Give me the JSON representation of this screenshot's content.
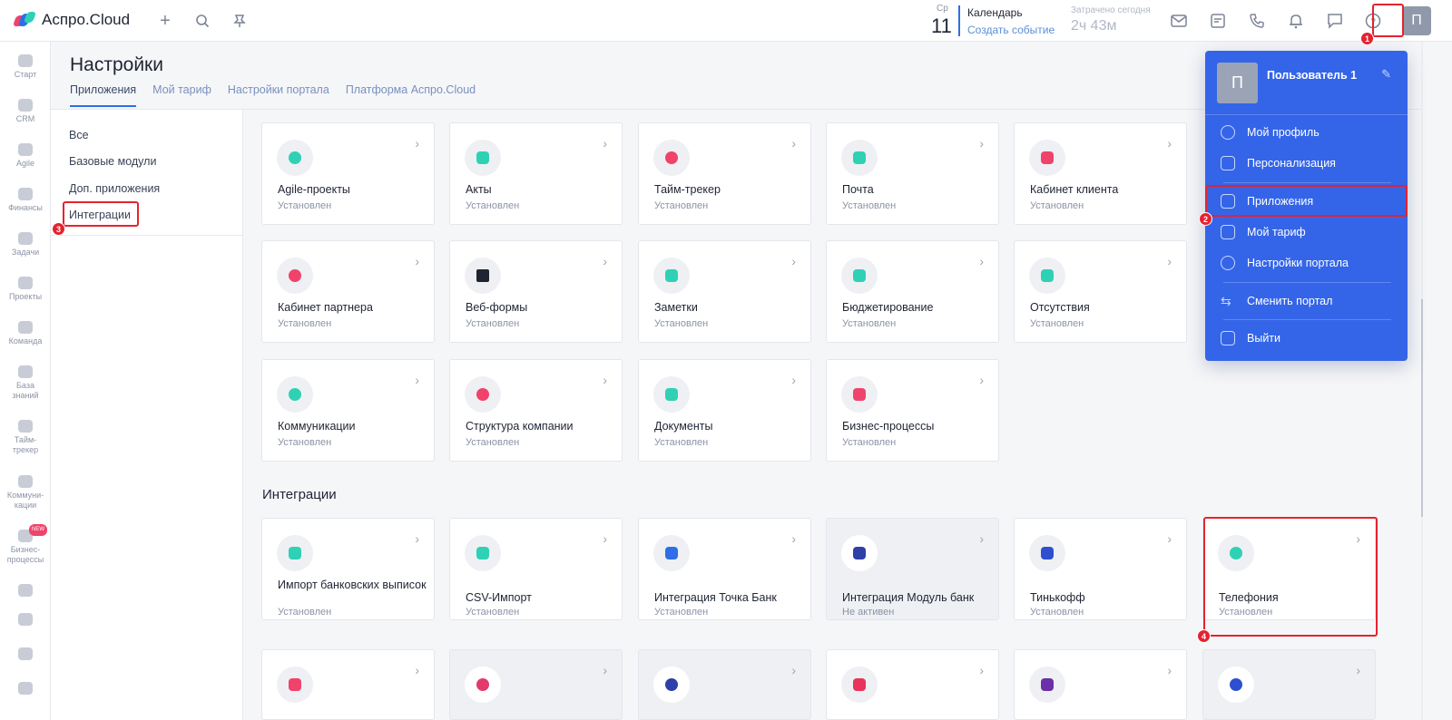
{
  "app": {
    "logo_text": "Аспро.Cloud"
  },
  "calendar": {
    "weekday": "Ср",
    "day": "11",
    "title": "Календарь",
    "link": "Создать событие"
  },
  "time_spent": {
    "label": "Затрачено сегодня",
    "value": "2ч 43м"
  },
  "user": {
    "initial": "П",
    "name": "Пользователь 1"
  },
  "rail": [
    {
      "label": "Старт"
    },
    {
      "label": "CRM"
    },
    {
      "label": "Agile"
    },
    {
      "label": "Финансы"
    },
    {
      "label": "Задачи"
    },
    {
      "label": "Проекты"
    },
    {
      "label": "Команда"
    },
    {
      "label": "База знаний"
    },
    {
      "label": "Тайм-трекер"
    },
    {
      "label": "Коммуни-кации"
    },
    {
      "label": "Бизнес-процессы",
      "badge": "NEW"
    }
  ],
  "page": {
    "title": "Настройки"
  },
  "tabs": [
    "Приложения",
    "Мой тариф",
    "Настройки портала",
    "Платформа Аспро.Cloud"
  ],
  "filters": [
    "Все",
    "Базовые модули",
    "Доп. приложения",
    "Интеграции"
  ],
  "apps": [
    {
      "name": "Agile-проекты",
      "status": "Установлен"
    },
    {
      "name": "Акты",
      "status": "Установлен"
    },
    {
      "name": "Тайм-трекер",
      "status": "Установлен"
    },
    {
      "name": "Почта",
      "status": "Установлен"
    },
    {
      "name": "Кабинет клиента",
      "status": "Установлен"
    },
    {
      "name": "Кабинет партнера",
      "status": "Установлен"
    },
    {
      "name": "Веб-формы",
      "status": "Установлен"
    },
    {
      "name": "Заметки",
      "status": "Установлен"
    },
    {
      "name": "Бюджетирование",
      "status": "Установлен"
    },
    {
      "name": "Отсутствия",
      "status": "Установлен"
    },
    {
      "name": "Коммуникации",
      "status": "Установлен"
    },
    {
      "name": "Структура компании",
      "status": "Установлен"
    },
    {
      "name": "Документы",
      "status": "Установлен"
    },
    {
      "name": "Бизнес-процессы",
      "status": "Установлен"
    }
  ],
  "integrations_title": "Интеграции",
  "integrations": [
    {
      "name": "Импорт банковских выписок",
      "status": "Установлен"
    },
    {
      "name": "CSV-Импорт",
      "status": "Установлен"
    },
    {
      "name": "Интеграция Точка Банк",
      "status": "Установлен"
    },
    {
      "name": "Интеграция Модуль банк",
      "status": "Не активен"
    },
    {
      "name": "Тинькофф",
      "status": "Установлен"
    },
    {
      "name": "Телефония",
      "status": "Установлен"
    }
  ],
  "menu": {
    "items": [
      "Мой профиль",
      "Персонализация",
      "Приложения",
      "Мой тариф",
      "Настройки портала",
      "Сменить портал",
      "Выйти"
    ]
  },
  "annotations": [
    "1",
    "2",
    "3",
    "4"
  ],
  "colors": {
    "accent": "#2e6ee6",
    "menu_bg": "#3465e8",
    "highlight": "#e4232f"
  }
}
